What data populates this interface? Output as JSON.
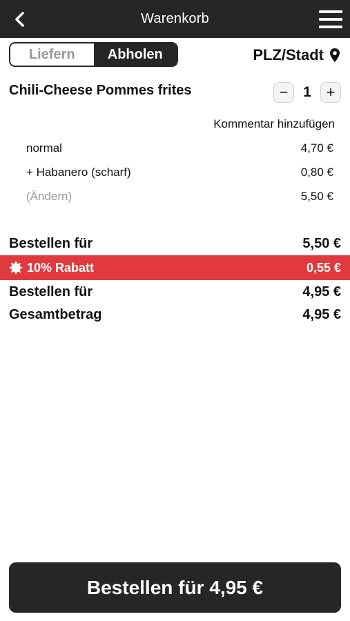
{
  "header": {
    "title": "Warenkorb",
    "back_icon": "chevron-left-icon",
    "menu_icon": "hamburger-menu-icon"
  },
  "mode_toggle": {
    "options": [
      "Liefern",
      "Abholen"
    ],
    "selected": "Abholen"
  },
  "location": {
    "label": "PLZ/Stadt",
    "icon": "map-pin-icon"
  },
  "cart_item": {
    "name": "Chili-Cheese Pommes frites",
    "quantity": "1",
    "minus_label": "−",
    "plus_label": "+",
    "comment_link": "Kommentar hinzufügen",
    "lines": [
      {
        "name": "normal",
        "price": "4,70 €"
      },
      {
        "name": "+ Habanero (scharf)",
        "price": "0,80 €"
      },
      {
        "name": "(Ändern)",
        "price": "5,50 €"
      }
    ]
  },
  "summary": {
    "order_for_label": "Bestellen für",
    "order_for_value": "5,50 €",
    "discount_label": "10% Rabatt",
    "discount_value": "0,55 €",
    "order_after_label": "Bestellen für",
    "order_after_value": "4,95 €",
    "total_label": "Gesamtbetrag",
    "total_value": "4,95 €"
  },
  "checkout_button": {
    "label": "Bestellen für 4,95 €"
  },
  "colors": {
    "header_bg": "#262626",
    "discount_bg": "#e03a3e",
    "button_bg": "#262626",
    "muted_text": "#9a9a9a"
  }
}
